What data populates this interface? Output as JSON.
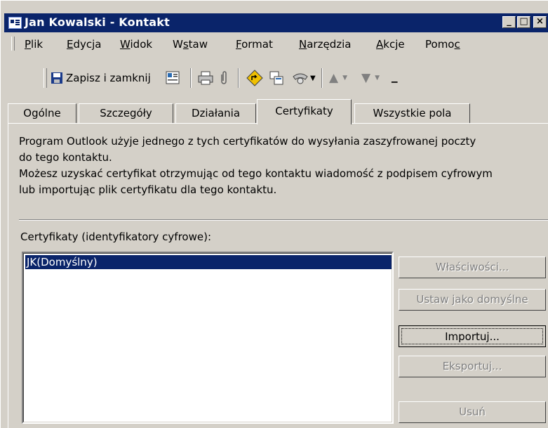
{
  "window": {
    "title": "Jan Kowalski - Kontakt",
    "controls": {
      "minimize": "_",
      "maximize": "□",
      "close": "×"
    }
  },
  "menu": {
    "items": [
      {
        "label": "Plik",
        "accel": "P"
      },
      {
        "label": "Edycja",
        "accel": "E"
      },
      {
        "label": "Widok",
        "accel": "W"
      },
      {
        "label": "Wstaw",
        "accel": "s"
      },
      {
        "label": "Format",
        "accel": "F"
      },
      {
        "label": "Narzędzia",
        "accel": "N"
      },
      {
        "label": "Akcje",
        "accel": "A"
      },
      {
        "label": "Pomoc",
        "accel": "c"
      }
    ]
  },
  "toolbar": {
    "save_close_label": "Zapisz i zamknij",
    "icons": [
      "save-icon",
      "business-card-icon",
      "print-icon",
      "attachment-icon",
      "follow-up-flag-icon",
      "new-meeting-icon",
      "dial-icon",
      "previous-item-icon",
      "next-item-icon"
    ]
  },
  "tabs": [
    {
      "label": "Ogólne",
      "active": false
    },
    {
      "label": "Szczegóły",
      "active": false
    },
    {
      "label": "Działania",
      "active": false
    },
    {
      "label": "Certyfikaty",
      "active": true
    },
    {
      "label": "Wszystkie pola",
      "active": false
    }
  ],
  "certificates_tab": {
    "info_line1": "Program Outlook użyje jednego z tych certyfikatów do wysyłania zaszyfrowanej poczty",
    "info_line2": "do tego kontaktu.",
    "info_line3": "Możesz uzyskać certyfikat otrzymując od tego kontaktu wiadomość z podpisem cyfrowym",
    "info_line4": "lub importując plik certyfikatu dla tego kontaktu.",
    "list_label": "Certyfikaty (identyfikatory cyfrowe):",
    "list_items": [
      "JK(Domyślny)"
    ],
    "selected_index": 0,
    "buttons": {
      "properties": "Właściwości...",
      "set_default": "Ustaw jako domyślne",
      "import": "Importuj...",
      "export": "Eksportuj...",
      "remove": "Usuń"
    }
  }
}
